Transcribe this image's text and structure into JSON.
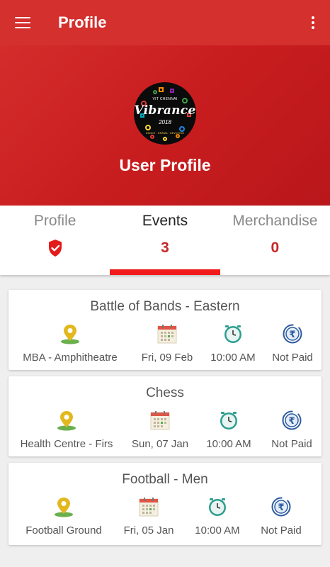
{
  "appbar": {
    "title": "Profile"
  },
  "hero": {
    "logo": {
      "top": "VIT CHENNAI",
      "name": "Vibrance",
      "year": "2018",
      "bottom": "DANCE · DRAMA · DEVOTION"
    },
    "title": "User Profile"
  },
  "tabs": [
    {
      "label": "Profile",
      "value": "",
      "icon": "shield-check-icon"
    },
    {
      "label": "Events",
      "value": "3"
    },
    {
      "label": "Merchandise",
      "value": "0"
    }
  ],
  "events": [
    {
      "name": "Battle of Bands - Eastern",
      "venue": "MBA - Amphitheatre",
      "date": "Fri, 09 Feb",
      "time": "10:00 AM",
      "payment": "Not Paid"
    },
    {
      "name": "Chess",
      "venue": "Health Centre - Firs",
      "date": "Sun, 07 Jan",
      "time": "10:00 AM",
      "payment": "Not Paid"
    },
    {
      "name": "Football - Men",
      "venue": "Football Ground",
      "date": "Fri, 05 Jan",
      "time": "10:00 AM",
      "payment": "Not Paid"
    }
  ],
  "colors": {
    "primary": "#d3302e",
    "accent": "#f21b1b",
    "count": "#c62828"
  }
}
